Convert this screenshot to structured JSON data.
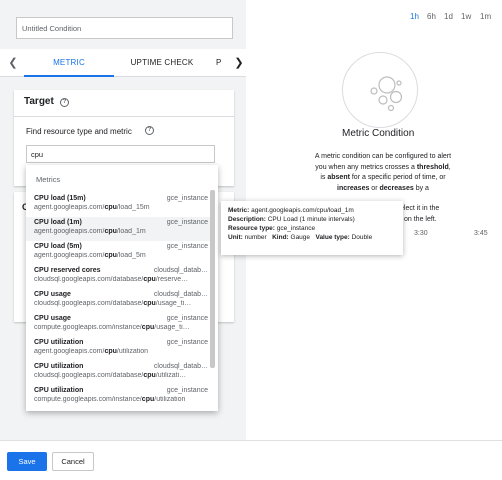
{
  "condition_name": "Untitled Condition",
  "tabs": {
    "metric": "METRIC",
    "uptime": "UPTIME CHECK",
    "partial": "P"
  },
  "target": {
    "title": "Target",
    "find_label": "Find resource type and metric",
    "search_value": "cpu"
  },
  "hidden_card_initial": "C",
  "dropdown": {
    "header": "Metrics",
    "items": [
      {
        "name": "CPU load (15m)",
        "type": "gce_instance",
        "path_pre": "agent.googleapis.com/",
        "path_bold": "cpu",
        "path_post": "/load_15m"
      },
      {
        "name": "CPU load (1m)",
        "type": "gce_instance",
        "path_pre": "agent.googleapis.com/",
        "path_bold": "cpu",
        "path_post": "/load_1m"
      },
      {
        "name": "CPU load (5m)",
        "type": "gce_instance",
        "path_pre": "agent.googleapis.com/",
        "path_bold": "cpu",
        "path_post": "/load_5m"
      },
      {
        "name": "CPU reserved cores",
        "type": "cloudsql_datab…",
        "path_pre": "cloudsql.googleapis.com/database/",
        "path_bold": "cpu",
        "path_post": "/reserve…"
      },
      {
        "name": "CPU usage",
        "type": "cloudsql_datab…",
        "path_pre": "cloudsql.googleapis.com/database/",
        "path_bold": "cpu",
        "path_post": "/usage_ti…"
      },
      {
        "name": "CPU usage",
        "type": "gce_instance",
        "path_pre": "compute.googleapis.com/instance/",
        "path_bold": "cpu",
        "path_post": "/usage_ti…"
      },
      {
        "name": "CPU utilization",
        "type": "gce_instance",
        "path_pre": "agent.googleapis.com/",
        "path_bold": "cpu",
        "path_post": "/utilization"
      },
      {
        "name": "CPU utilization",
        "type": "cloudsql_datab…",
        "path_pre": "cloudsql.googleapis.com/database/",
        "path_bold": "cpu",
        "path_post": "/utilizati…"
      },
      {
        "name": "CPU utilization",
        "type": "gce_instance",
        "path_pre": "compute.googleapis.com/instance/",
        "path_bold": "cpu",
        "path_post": "/utilization"
      }
    ]
  },
  "tooltip": {
    "metric_label": "Metric:",
    "metric_value": "agent.googleapis.com/cpu/load_1m",
    "desc_label": "Description:",
    "desc_value": "CPU Load (1 minute intervals)",
    "rtype_label": "Resource type:",
    "rtype_value": "gce_instance",
    "unit_label": "Unit:",
    "unit_value": "number",
    "kind_label": "Kind:",
    "kind_value": "Gauge",
    "vtype_label": "Value type:",
    "vtype_value": "Double"
  },
  "time_ranges": [
    "1h",
    "6h",
    "1d",
    "1w",
    "1m"
  ],
  "metric_condition": {
    "title": "Metric Condition",
    "p1": "A metric condition can be configured to alert you when any metrics crosses a ",
    "b1": "threshold",
    "p2": ", is ",
    "b2": "absent",
    "p3": " for a specific period of time, or ",
    "b3": "increases",
    "p4": " or ",
    "b4": "decreases",
    "p5": " by a",
    "line_frag1": "elect it in the",
    "line_frag2": "on the left."
  },
  "axis_labels": [
    "3:30",
    "3:45"
  ],
  "footer": {
    "save": "Save",
    "cancel": "Cancel"
  },
  "colors": {
    "accent": "#1a73e8",
    "panel_bg": "#f1f3f4"
  }
}
